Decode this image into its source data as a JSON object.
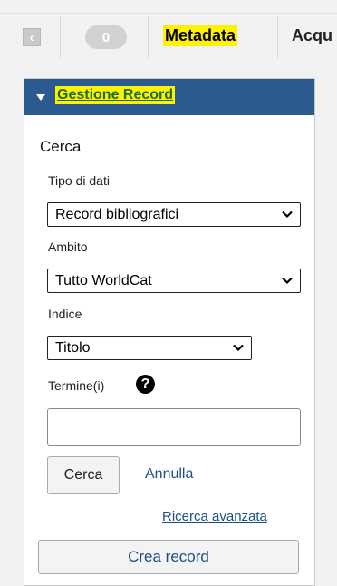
{
  "topbar": {
    "badge_count": "0",
    "tab_metadata": "Metadata",
    "tab_acquisitions": "Acqu"
  },
  "panel": {
    "title": "Gestione Record",
    "section_title": "Cerca"
  },
  "form": {
    "data_type_label": "Tipo di dati",
    "data_type_value": "Record bibliografici",
    "scope_label": "Ambito",
    "scope_value": "Tutto WorldCat",
    "index_label": "Indice",
    "index_value": "Titolo",
    "terms_label": "Termine(i)",
    "terms_value": ""
  },
  "actions": {
    "search_button": "Cerca",
    "cancel_link": "Annulla",
    "advanced_search_link": "Ricerca avanzata",
    "create_record_button": "Crea record"
  },
  "colors": {
    "header_blue": "#2b5a91",
    "highlight_yellow": "#fff200",
    "link_blue": "#1a4f86"
  }
}
